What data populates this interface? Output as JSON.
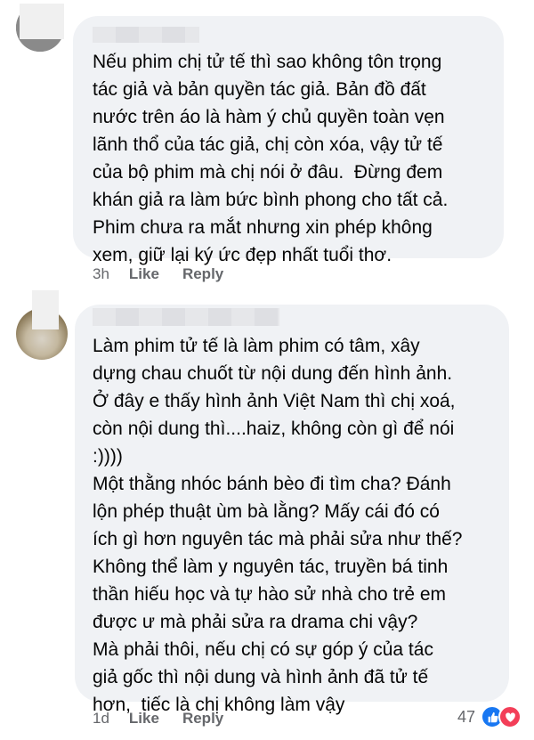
{
  "comments": [
    {
      "text": "Nếu phim chị tử tế thì sao không tôn trọng\ntác giả và bản quyền tác giả. Bản đồ đất\nnước trên áo là hàm ý chủ quyền toàn vẹn\nlãnh thổ của tác giả, chị còn xóa, vậy tử tế\ncủa bộ phim mà chị nói ở đâu.  Đừng đem\nkhán giả ra làm bức bình phong cho tất cả.\nPhim chưa ra mắt nhưng xin phép không\nxem, giữ lại ký ức đẹp nhất tuổi thơ.",
      "time": "3h",
      "like_label": "Like",
      "reply_label": "Reply"
    },
    {
      "text": "Làm phim tử tế là làm phim có tâm, xây\ndựng chau chuốt từ nội dung đến hình ảnh.\nỞ đây e thấy hình ảnh Việt Nam thì chị xoá,\ncòn nội dung thì....haiz, không còn gì để nói\n:))))\nMột thằng nhóc bánh bèo đi tìm cha? Đánh\nlộn phép thuật ùm bà lằng? Mấy cái đó có\ních gì hơn nguyên tác mà phải sửa như thế?\nKhông thể làm y nguyên tác, truyền bá tinh\nthần hiếu học và tự hào sử nhà cho trẻ em\nđược ư mà phải sửa ra drama chi vậy?\nMà phải thôi, nếu chị có sự góp ý của tác\ngiả gốc thì nội dung và hình ảnh đã tử tế\nhơn,  tiếc là chị không làm vậy",
      "time": "1d",
      "like_label": "Like",
      "reply_label": "Reply",
      "reaction_count": "47",
      "reaction_icons": [
        "like-icon",
        "love-icon"
      ]
    }
  ],
  "colors": {
    "bubble": "#f0f2f5",
    "meta_text": "#65676b",
    "like_blue": "#1877f2",
    "love_red": "#f33e58"
  }
}
